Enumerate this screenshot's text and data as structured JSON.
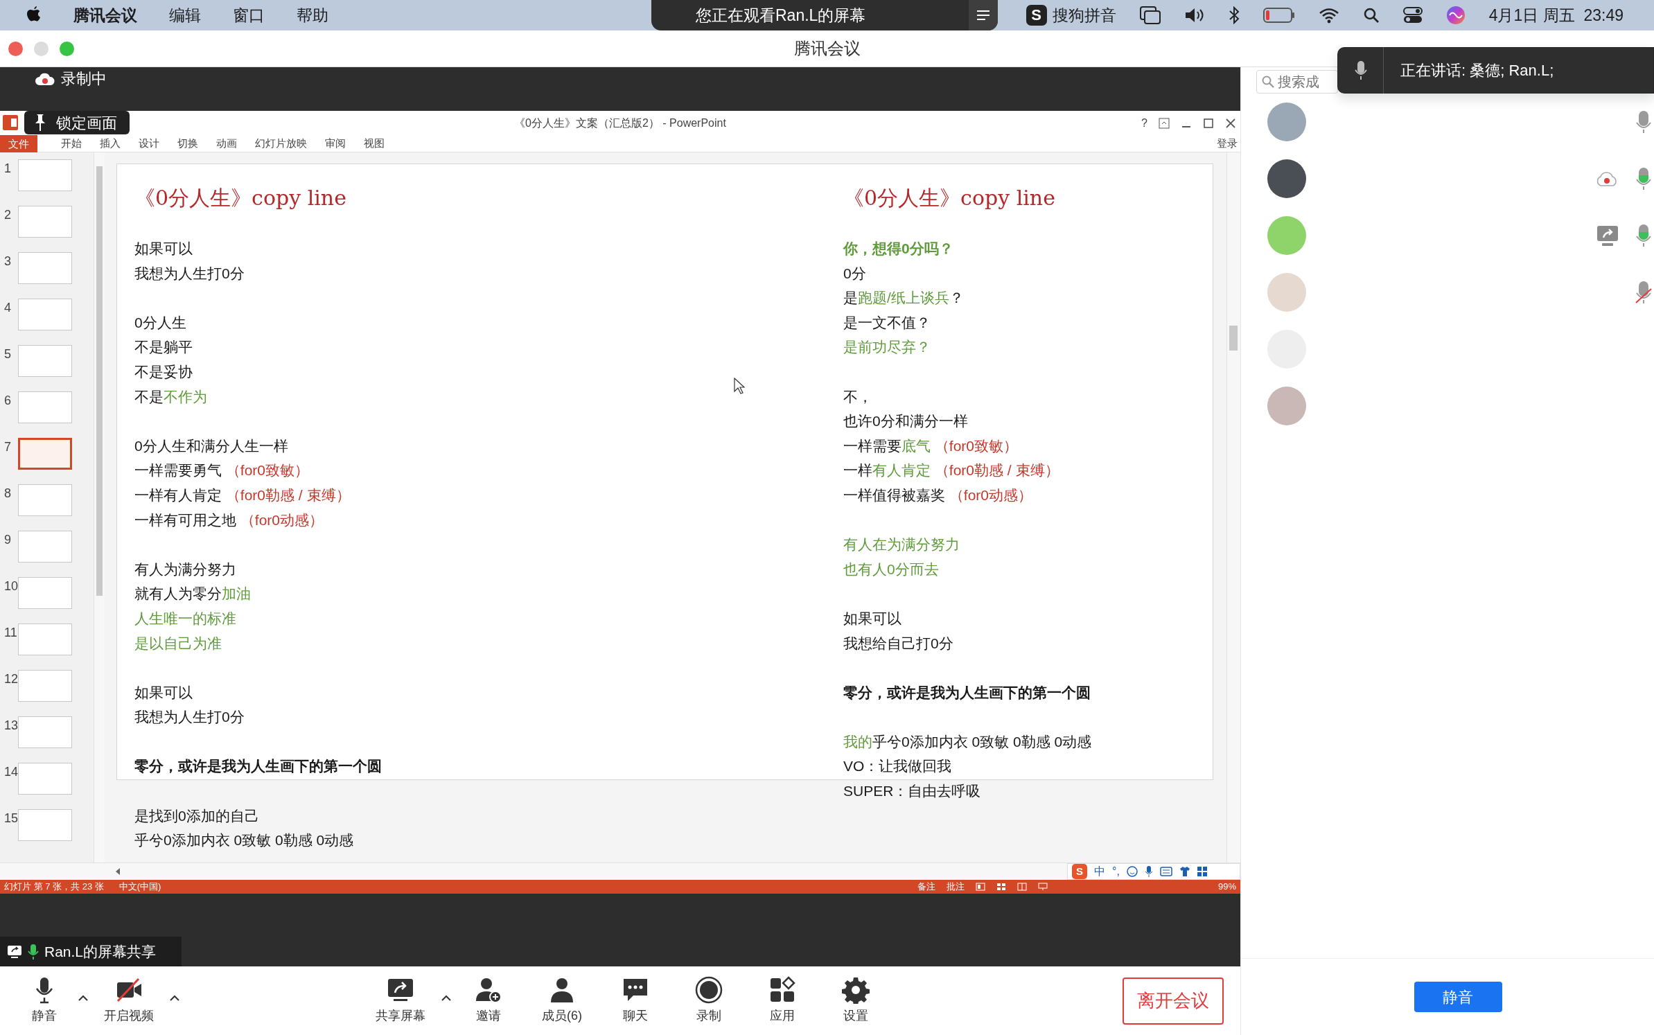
{
  "menu_bar": {
    "menus": [
      {
        "label": "腾讯会议",
        "kind": "app"
      },
      {
        "label": "编辑",
        "kind": "menu"
      },
      {
        "label": "窗口",
        "kind": "menu"
      },
      {
        "label": "帮助",
        "kind": "menu"
      }
    ],
    "viewing_banner": "您正在观看Ran.L的屏幕",
    "ime_logo": "S",
    "ime_name": "搜狗拼音",
    "clock": "4月1日 周五  23:49"
  },
  "window": {
    "title": "腾讯会议"
  },
  "recording_label": "录制中",
  "lock_label": "锁定画面",
  "powerpoint": {
    "title": "《0分人生》文案（汇总版2） - PowerPoint",
    "help": "?",
    "ribbon_tabs": [
      {
        "label": "文件",
        "kind": "file"
      },
      {
        "label": "开始",
        "kind": "tab"
      },
      {
        "label": "插入",
        "kind": "tab"
      },
      {
        "label": "设计",
        "kind": "tab"
      },
      {
        "label": "切换",
        "kind": "tab"
      },
      {
        "label": "动画",
        "kind": "tab"
      },
      {
        "label": "幻灯片放映",
        "kind": "tab"
      },
      {
        "label": "审阅",
        "kind": "tab"
      },
      {
        "label": "视图",
        "kind": "tab"
      }
    ],
    "sign_in": "登录",
    "thumbnails": [
      {
        "number": "1",
        "selected": false
      },
      {
        "number": "2",
        "selected": false
      },
      {
        "number": "3",
        "selected": false
      },
      {
        "number": "4",
        "selected": false
      },
      {
        "number": "5",
        "selected": false
      },
      {
        "number": "6",
        "selected": false
      },
      {
        "number": "7",
        "selected": true
      },
      {
        "number": "8",
        "selected": false
      },
      {
        "number": "9",
        "selected": false
      },
      {
        "number": "10",
        "selected": false
      },
      {
        "number": "11",
        "selected": false
      },
      {
        "number": "12",
        "selected": false
      },
      {
        "number": "13",
        "selected": false
      },
      {
        "number": "14",
        "selected": false
      },
      {
        "number": "15",
        "selected": false
      }
    ],
    "slide": {
      "columns": [
        {
          "title": "《0分人生》copy line",
          "paragraphs": [
            [
              {
                "bold": false,
                "segments": [
                  {
                    "text": "如果可以"
                  }
                ]
              },
              {
                "bold": false,
                "segments": [
                  {
                    "text": "我想为人生打0分"
                  }
                ]
              }
            ],
            [
              {
                "bold": false,
                "segments": [
                  {
                    "text": "0分人生"
                  }
                ]
              },
              {
                "bold": false,
                "segments": [
                  {
                    "text": "不是躺平"
                  }
                ]
              },
              {
                "bold": false,
                "segments": [
                  {
                    "text": "不是妥协"
                  }
                ]
              },
              {
                "bold": false,
                "segments": [
                  {
                    "text": "不是"
                  },
                  {
                    "text": "不作为",
                    "color": "#5e9b3a"
                  }
                ]
              }
            ],
            [
              {
                "bold": false,
                "segments": [
                  {
                    "text": "0分人生和满分人生一样"
                  }
                ]
              },
              {
                "bold": false,
                "segments": [
                  {
                    "text": "一样需要勇气 "
                  },
                  {
                    "text": "（for0致敏）",
                    "color": "#c4372a"
                  }
                ]
              },
              {
                "bold": false,
                "segments": [
                  {
                    "text": "一样有人肯定 "
                  },
                  {
                    "text": "（for0勒感 / 束缚）",
                    "color": "#c4372a"
                  }
                ]
              },
              {
                "bold": false,
                "segments": [
                  {
                    "text": "一样有可用之地 "
                  },
                  {
                    "text": "（for0动感）",
                    "color": "#c4372a"
                  }
                ]
              }
            ],
            [
              {
                "bold": false,
                "segments": [
                  {
                    "text": "有人为满分努力"
                  }
                ]
              },
              {
                "bold": false,
                "segments": [
                  {
                    "text": "就有人为零分"
                  },
                  {
                    "text": "加油",
                    "color": "#5e9b3a"
                  }
                ]
              },
              {
                "bold": false,
                "segments": [
                  {
                    "text": "人生唯一的标准",
                    "color": "#5e9b3a"
                  }
                ]
              },
              {
                "bold": false,
                "segments": [
                  {
                    "text": "是以自己为准",
                    "color": "#5e9b3a"
                  }
                ]
              }
            ],
            [
              {
                "bold": false,
                "segments": [
                  {
                    "text": "如果可以"
                  }
                ]
              },
              {
                "bold": false,
                "segments": [
                  {
                    "text": "我想为人生打0分"
                  }
                ]
              }
            ],
            [
              {
                "bold": true,
                "segments": [
                  {
                    "text": "零分，或许是我为人生画下的第一个圆"
                  }
                ]
              }
            ],
            [
              {
                "bold": false,
                "segments": [
                  {
                    "text": "是找到0添加的自己"
                  }
                ]
              },
              {
                "bold": false,
                "segments": [
                  {
                    "text": "乎兮0添加内衣 0致敏 0勒感 0动感"
                  }
                ]
              }
            ]
          ]
        },
        {
          "title": "《0分人生》copy line",
          "paragraphs": [
            [
              {
                "bold": true,
                "segments": [
                  {
                    "text": "你，想得0分吗？",
                    "color": "#5e9b3a"
                  }
                ]
              },
              {
                "bold": false,
                "segments": [
                  {
                    "text": "0分"
                  }
                ]
              },
              {
                "bold": false,
                "segments": [
                  {
                    "text": "是"
                  },
                  {
                    "text": "跑题/纸上谈兵",
                    "color": "#5e9b3a"
                  },
                  {
                    "text": "？"
                  }
                ]
              },
              {
                "bold": false,
                "segments": [
                  {
                    "text": "是一文不值？"
                  }
                ]
              },
              {
                "bold": false,
                "segments": [
                  {
                    "text": "是前功尽弃？",
                    "color": "#5e9b3a"
                  }
                ]
              }
            ],
            [
              {
                "bold": false,
                "segments": [
                  {
                    "text": "不，"
                  }
                ]
              },
              {
                "bold": false,
                "segments": [
                  {
                    "text": "也许0分和满分一样"
                  }
                ]
              },
              {
                "bold": false,
                "segments": [
                  {
                    "text": "一样需要"
                  },
                  {
                    "text": "底气",
                    "color": "#5e9b3a"
                  },
                  {
                    "text": " （for0致敏）",
                    "color": "#c4372a"
                  }
                ]
              },
              {
                "bold": false,
                "segments": [
                  {
                    "text": "一样"
                  },
                  {
                    "text": "有人肯定",
                    "color": "#5e9b3a"
                  },
                  {
                    "text": " （for0勒感 / 束缚）",
                    "color": "#c4372a"
                  }
                ]
              },
              {
                "bold": false,
                "segments": [
                  {
                    "text": "一样值得被嘉奖 "
                  },
                  {
                    "text": "（for0动感）",
                    "color": "#c4372a"
                  }
                ]
              }
            ],
            [
              {
                "bold": false,
                "segments": [
                  {
                    "text": "有人在为满分努力",
                    "color": "#5e9b3a"
                  }
                ]
              },
              {
                "bold": false,
                "segments": [
                  {
                    "text": "也有人0分而去",
                    "color": "#5e9b3a"
                  }
                ]
              }
            ],
            [
              {
                "bold": false,
                "segments": [
                  {
                    "text": "如果可以"
                  }
                ]
              },
              {
                "bold": false,
                "segments": [
                  {
                    "text": "我想给自己打0分"
                  }
                ]
              }
            ],
            [
              {
                "bold": true,
                "segments": [
                  {
                    "text": "零分，或许是我为人生画下的第一个圆"
                  }
                ]
              }
            ],
            [
              {
                "bold": false,
                "segments": [
                  {
                    "text": "我的",
                    "color": "#5e9b3a"
                  },
                  {
                    "text": "乎兮0添加内衣 0致敏 0勒感 0动感"
                  }
                ]
              },
              {
                "bold": false,
                "segments": [
                  {
                    "text": "VO：让我做回我"
                  }
                ]
              },
              {
                "bold": false,
                "segments": [
                  {
                    "text": "SUPER：自由去呼吸"
                  }
                ]
              }
            ]
          ]
        }
      ]
    },
    "status_bar": {
      "slide_info": "幻灯片 第 7 张，共 23 张",
      "language": "中文(中国)",
      "notes": "备注",
      "comments": "批注",
      "zoom": "99%"
    },
    "ime_bar": {
      "logo": "S",
      "mode": "中",
      "punctuation": "°,"
    }
  },
  "share_label": "Ran.L的屏幕共享",
  "toolbar": [
    {
      "kind": "mic",
      "label": "静音",
      "caret": true
    },
    {
      "kind": "video",
      "label": "开启视频",
      "caret": true
    },
    {
      "kind": "share",
      "label": "共享屏幕",
      "caret": true
    },
    {
      "kind": "invite",
      "label": "邀请",
      "caret": false
    },
    {
      "kind": "members",
      "label": "成员(6)",
      "caret": false
    },
    {
      "kind": "chat",
      "label": "聊天",
      "caret": false
    },
    {
      "kind": "record",
      "label": "录制",
      "caret": false
    },
    {
      "kind": "apps",
      "label": "应用",
      "caret": false
    },
    {
      "kind": "settings",
      "label": "设置",
      "caret": false
    }
  ],
  "leave_button": "离开会议",
  "side_panel": {
    "search": {
      "placeholder": "搜索成"
    },
    "speaking_toast": "正在讲话: 桑德; Ran.L;",
    "participants": [
      {
        "mic_icon": true,
        "speaking": false,
        "muted": false,
        "recording": false,
        "sharing": false
      },
      {
        "mic_icon": true,
        "speaking": true,
        "muted": false,
        "recording": true,
        "sharing": false
      },
      {
        "mic_icon": true,
        "speaking": true,
        "muted": false,
        "recording": false,
        "sharing": true
      },
      {
        "mic_icon": true,
        "speaking": false,
        "muted": true,
        "recording": false,
        "sharing": false
      },
      {
        "mic_icon": false,
        "speaking": false,
        "muted": false,
        "recording": false,
        "sharing": false
      },
      {
        "mic_icon": false,
        "speaking": false,
        "muted": false,
        "recording": false,
        "sharing": false
      }
    ],
    "mute_button": "静音"
  }
}
